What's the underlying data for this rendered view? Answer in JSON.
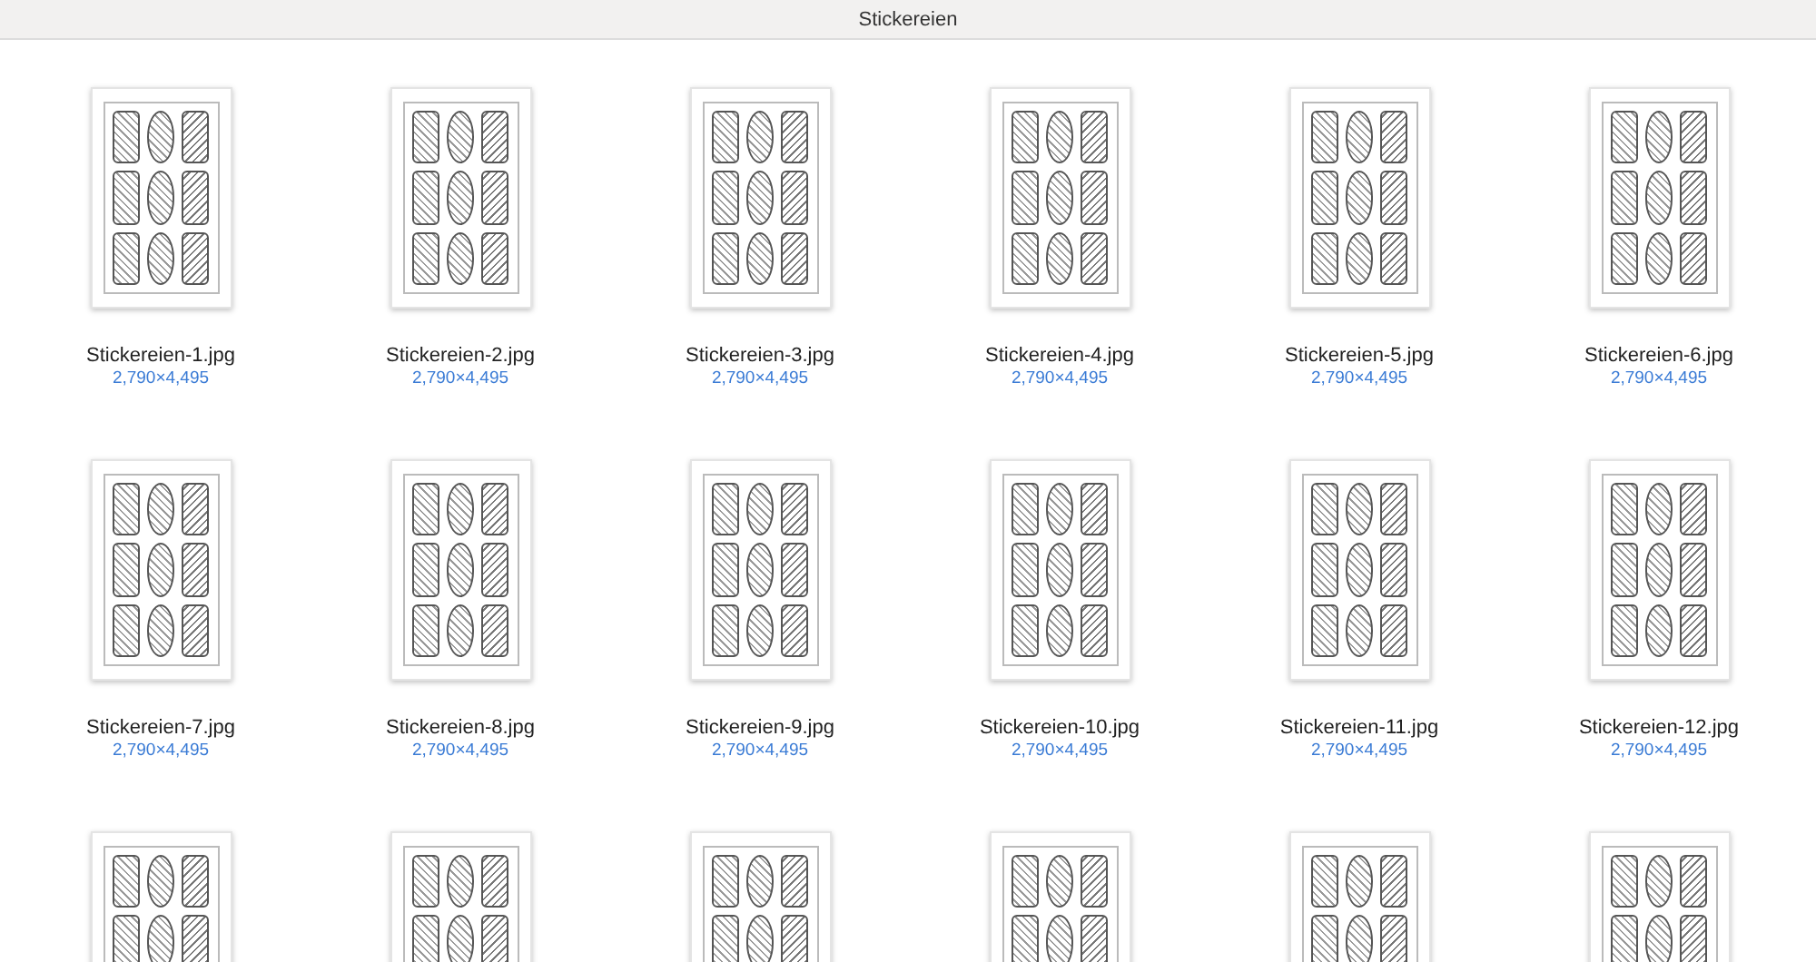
{
  "window": {
    "title": "Stickereien"
  },
  "files": [
    {
      "kind": "image",
      "name": "Stickereien-1.jpg",
      "info": "2,790×4,495"
    },
    {
      "kind": "image",
      "name": "Stickereien-2.jpg",
      "info": "2,790×4,495"
    },
    {
      "kind": "image",
      "name": "Stickereien-3.jpg",
      "info": "2,790×4,495"
    },
    {
      "kind": "image",
      "name": "Stickereien-4.jpg",
      "info": "2,790×4,495"
    },
    {
      "kind": "image",
      "name": "Stickereien-5.jpg",
      "info": "2,790×4,495"
    },
    {
      "kind": "image",
      "name": "Stickereien-6.jpg",
      "info": "2,790×4,495"
    },
    {
      "kind": "image",
      "name": "Stickereien-7.jpg",
      "info": "2,790×4,495"
    },
    {
      "kind": "image",
      "name": "Stickereien-8.jpg",
      "info": "2,790×4,495"
    },
    {
      "kind": "image",
      "name": "Stickereien-9.jpg",
      "info": "2,790×4,495"
    },
    {
      "kind": "image",
      "name": "Stickereien-10.jpg",
      "info": "2,790×4,495"
    },
    {
      "kind": "image",
      "name": "Stickereien-11.jpg",
      "info": "2,790×4,495"
    },
    {
      "kind": "image",
      "name": "Stickereien-12.jpg",
      "info": "2,790×4,495"
    },
    {
      "kind": "image"
    },
    {
      "kind": "image"
    },
    {
      "kind": "image"
    },
    {
      "kind": "image"
    },
    {
      "kind": "image"
    },
    {
      "kind": "image"
    }
  ]
}
